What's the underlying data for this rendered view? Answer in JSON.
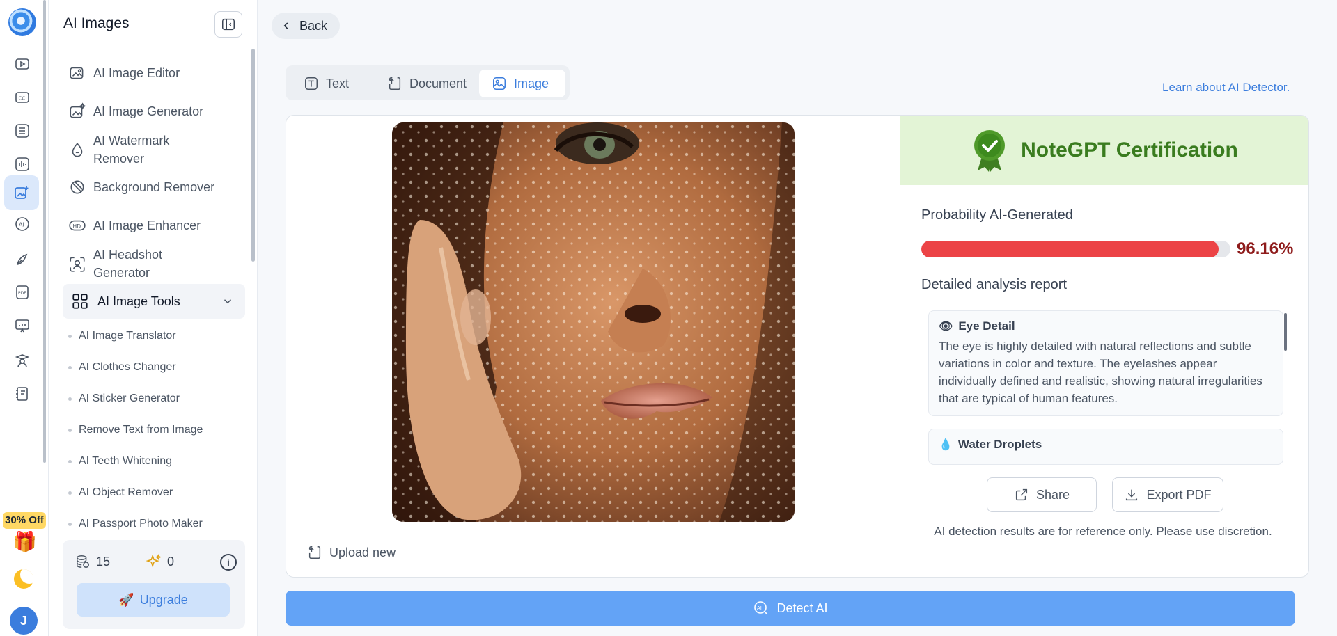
{
  "rail": {
    "icons": [
      "video-icon",
      "cc-icon",
      "list-icon",
      "audio-icon",
      "image-edit-icon",
      "ai-icon",
      "pen-icon",
      "pdf-icon",
      "presentation-icon",
      "teacher-icon",
      "notebook-icon"
    ],
    "promo": "30% Off",
    "avatar_initial": "J"
  },
  "sidebar": {
    "title": "AI Images",
    "items": [
      {
        "label": "AI Image Editor",
        "icon": "image-edit-icon"
      },
      {
        "label": "AI Image Generator",
        "icon": "image-sparkle-icon"
      },
      {
        "label": "AI Watermark\nRemover",
        "icon": "watermark-icon"
      },
      {
        "label": "Background Remover",
        "icon": "background-icon"
      },
      {
        "label": "AI Image Enhancer",
        "icon": "hd-icon"
      },
      {
        "label": "AI Headshot\nGenerator",
        "icon": "headshot-icon"
      }
    ],
    "group": {
      "label": "AI Image Tools",
      "icon": "grid-icon"
    },
    "subitems": [
      "AI Image Translator",
      "AI Clothes Changer",
      "AI Sticker Generator",
      "Remove Text from Image",
      "AI Teeth Whitening",
      "AI Object Remover",
      "AI Passport Photo Maker"
    ],
    "credits": {
      "coins": "15",
      "sparks": "0"
    },
    "upgrade_label": "Upgrade"
  },
  "topbar": {
    "back_label": "Back"
  },
  "tabs": [
    {
      "label": "Text",
      "active": false
    },
    {
      "label": "Document",
      "active": false
    },
    {
      "label": "Image",
      "active": true
    }
  ],
  "learn_link": "Learn about AI Detector.",
  "upload_label": "Upload new",
  "result": {
    "certification": "NoteGPT Certification",
    "probability_label": "Probability AI-Generated",
    "probability_value": "96.16%",
    "probability_fraction": 0.9616,
    "detail_label": "Detailed analysis report",
    "cards": [
      {
        "title": "Eye Detail",
        "icon": "eye-icon",
        "text": "The eye is highly detailed with natural reflections and subtle variations in color and texture. The eyelashes appear individually defined and realistic, showing natural irregularities that are typical of human features."
      },
      {
        "title": "Water Droplets",
        "icon": "droplet-icon",
        "text": ""
      }
    ],
    "share_label": "Share",
    "export_label": "Export PDF",
    "disclaimer": "AI detection results are for reference only. Please use discretion."
  },
  "detect_label": "Detect AI",
  "colors": {
    "accent": "#3b7ddd",
    "danger": "#ec4346",
    "success": "#3a7c1f"
  }
}
